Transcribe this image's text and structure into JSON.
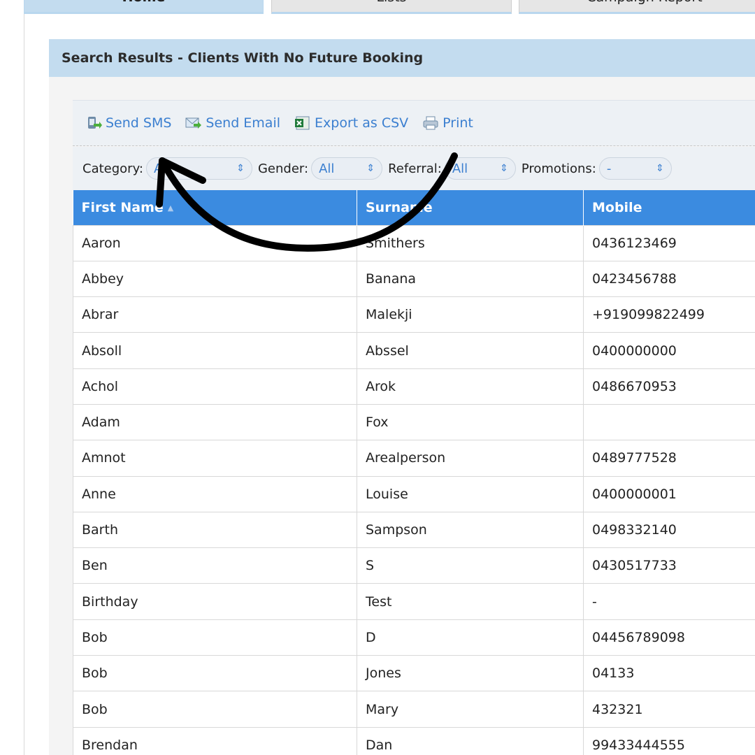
{
  "tabs": [
    {
      "label": "Home",
      "active": true
    },
    {
      "label": "Lists",
      "active": false
    },
    {
      "label": "Campaign Report",
      "active": false
    }
  ],
  "panel": {
    "title": "Search Results - Clients With No Future Booking"
  },
  "toolbar": {
    "send_sms": "Send SMS",
    "send_email": "Send Email",
    "export_csv": "Export as CSV",
    "print": "Print"
  },
  "filters": {
    "category": {
      "label": "Category:",
      "value": "All"
    },
    "gender": {
      "label": "Gender:",
      "value": "All"
    },
    "referral": {
      "label": "Referral:",
      "value": "All"
    },
    "promotions": {
      "label": "Promotions:",
      "value": "-"
    }
  },
  "table": {
    "headers": [
      "First Name",
      "Surname",
      "Mobile"
    ],
    "rows": [
      [
        "Aaron",
        "Smithers",
        "0436123469"
      ],
      [
        "Abbey",
        "Banana",
        "0423456788"
      ],
      [
        "Abrar",
        "Malekji",
        "+919099822499"
      ],
      [
        "Absoll",
        "Abssel",
        "0400000000"
      ],
      [
        "Achol",
        "Arok",
        "0486670953"
      ],
      [
        "Adam",
        "Fox",
        ""
      ],
      [
        "Amnot",
        "Arealperson",
        "0489777528"
      ],
      [
        "Anne",
        "Louise",
        "0400000001"
      ],
      [
        "Barth",
        "Sampson",
        "0498332140"
      ],
      [
        "Ben",
        "S",
        "0430517733"
      ],
      [
        "Birthday",
        "Test",
        "-"
      ],
      [
        "Bob",
        "D",
        "04456789098"
      ],
      [
        "Bob",
        "Jones",
        "04133"
      ],
      [
        "Bob",
        "Mary",
        "432321"
      ],
      [
        "Brendan",
        "Dan",
        "99433444555"
      ]
    ]
  },
  "icons": {
    "sms": "sms-icon",
    "email": "email-icon",
    "csv": "excel-icon",
    "print": "printer-icon",
    "sort": "sort-ascending-icon",
    "chevron": "chevron-updown-icon"
  },
  "colors": {
    "header_bg": "#3b8be0",
    "panel_header": "#c3dcef",
    "link": "#3b7fd0"
  }
}
